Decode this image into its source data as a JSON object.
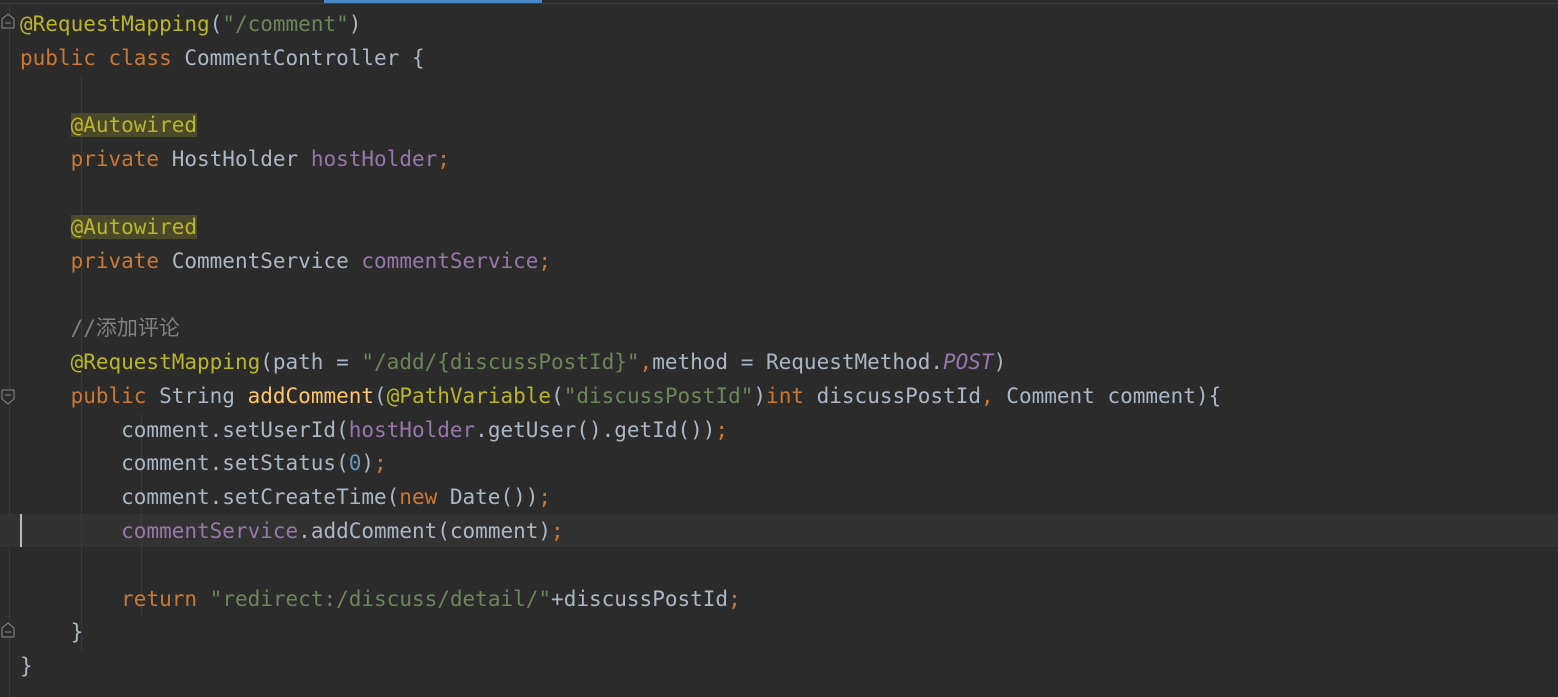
{
  "editor": {
    "language": "Java",
    "current_line": 16,
    "lines": [
      [
        {
          "t": "@RequestMapping",
          "c": "ann"
        },
        {
          "t": "(",
          "c": "plain"
        },
        {
          "t": "\"/comment\"",
          "c": "str"
        },
        {
          "t": ")",
          "c": "plain"
        }
      ],
      [
        {
          "t": "public class ",
          "c": "kw"
        },
        {
          "t": "CommentController {",
          "c": "plain"
        }
      ],
      [],
      [
        {
          "t": "    ",
          "c": "plain"
        },
        {
          "t": "@Autowired",
          "c": "ann-hl"
        }
      ],
      [
        {
          "t": "    ",
          "c": "plain"
        },
        {
          "t": "private ",
          "c": "kw"
        },
        {
          "t": "HostHolder ",
          "c": "plain"
        },
        {
          "t": "hostHolder",
          "c": "fld"
        },
        {
          "t": ";",
          "c": "kw"
        }
      ],
      [],
      [
        {
          "t": "    ",
          "c": "plain"
        },
        {
          "t": "@Autowired",
          "c": "ann-hl"
        }
      ],
      [
        {
          "t": "    ",
          "c": "plain"
        },
        {
          "t": "private ",
          "c": "kw"
        },
        {
          "t": "CommentService ",
          "c": "plain"
        },
        {
          "t": "commentService",
          "c": "fld"
        },
        {
          "t": ";",
          "c": "kw"
        }
      ],
      [],
      [
        {
          "t": "    ",
          "c": "plain"
        },
        {
          "t": "//添加评论",
          "c": "cmt"
        }
      ],
      [
        {
          "t": "    ",
          "c": "plain"
        },
        {
          "t": "@RequestMapping",
          "c": "ann"
        },
        {
          "t": "(path = ",
          "c": "plain"
        },
        {
          "t": "\"/add/{discussPostId}\"",
          "c": "str"
        },
        {
          "t": ",",
          "c": "kw"
        },
        {
          "t": "method = RequestMethod.",
          "c": "plain"
        },
        {
          "t": "POST",
          "c": "fld-i"
        },
        {
          "t": ")",
          "c": "plain"
        }
      ],
      [
        {
          "t": "    ",
          "c": "plain"
        },
        {
          "t": "public ",
          "c": "kw"
        },
        {
          "t": "String ",
          "c": "plain"
        },
        {
          "t": "addComment",
          "c": "fn"
        },
        {
          "t": "(",
          "c": "plain"
        },
        {
          "t": "@PathVariable",
          "c": "ann"
        },
        {
          "t": "(",
          "c": "plain"
        },
        {
          "t": "\"discussPostId\"",
          "c": "str"
        },
        {
          "t": ")",
          "c": "plain"
        },
        {
          "t": "int ",
          "c": "kw"
        },
        {
          "t": "discussPostId",
          "c": "plain"
        },
        {
          "t": ", ",
          "c": "kw"
        },
        {
          "t": "Comment comment){",
          "c": "plain"
        }
      ],
      [
        {
          "t": "        comment.setUserId(",
          "c": "plain"
        },
        {
          "t": "hostHolder",
          "c": "fld"
        },
        {
          "t": ".getUser().getId())",
          "c": "plain"
        },
        {
          "t": ";",
          "c": "kw"
        }
      ],
      [
        {
          "t": "        comment.setStatus(",
          "c": "plain"
        },
        {
          "t": "0",
          "c": "num"
        },
        {
          "t": ")",
          "c": "plain"
        },
        {
          "t": ";",
          "c": "kw"
        }
      ],
      [
        {
          "t": "        comment.setCreateTime(",
          "c": "plain"
        },
        {
          "t": "new ",
          "c": "kw"
        },
        {
          "t": "Date())",
          "c": "plain"
        },
        {
          "t": ";",
          "c": "kw"
        }
      ],
      [
        {
          "t": "        ",
          "c": "plain"
        },
        {
          "t": "commentService",
          "c": "fld"
        },
        {
          "t": ".addComment(comment)",
          "c": "plain"
        },
        {
          "t": ";",
          "c": "kw"
        }
      ],
      [],
      [
        {
          "t": "        ",
          "c": "plain"
        },
        {
          "t": "return ",
          "c": "kw"
        },
        {
          "t": "\"redirect:/discuss/detail/\"",
          "c": "str"
        },
        {
          "t": "+discussPostId",
          "c": "plain"
        },
        {
          "t": ";",
          "c": "kw"
        }
      ],
      [
        {
          "t": "    }",
          "c": "plain"
        }
      ],
      [
        {
          "t": "}",
          "c": "plain"
        }
      ]
    ]
  }
}
